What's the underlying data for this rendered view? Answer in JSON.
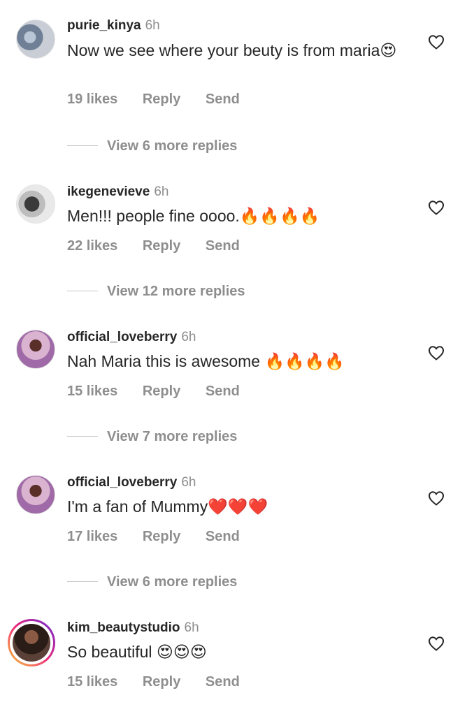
{
  "comments": [
    {
      "username": "purie_kinya",
      "time": "6h",
      "text": "Now we see where your beuty is from maria😍",
      "likes": "19 likes",
      "reply": "Reply",
      "send": "Send",
      "view_more": "View 6 more replies"
    },
    {
      "username": "ikegenevieve",
      "time": "6h",
      "text": "Men!!! people fine  oooo.🔥🔥🔥🔥",
      "likes": "22 likes",
      "reply": "Reply",
      "send": "Send",
      "view_more": "View 12 more replies"
    },
    {
      "username": "official_loveberry",
      "time": "6h",
      "text": "Nah Maria this is awesome 🔥🔥🔥🔥",
      "likes": "15 likes",
      "reply": "Reply",
      "send": "Send",
      "view_more": "View 7 more replies"
    },
    {
      "username": "official_loveberry",
      "time": "6h",
      "text": "I'm a fan of Mummy❤️❤️❤️",
      "likes": "17 likes",
      "reply": "Reply",
      "send": "Send",
      "view_more": "View 6 more replies"
    },
    {
      "username": "kim_beautystudio",
      "time": "6h",
      "text": "So beautiful 😍😍😍",
      "likes": "15 likes",
      "reply": "Reply",
      "send": "Send"
    }
  ],
  "icons": {
    "like": "heart-outline-icon"
  },
  "colors": {
    "primary_text": "#262626",
    "secondary_text": "#8e8e8e"
  }
}
